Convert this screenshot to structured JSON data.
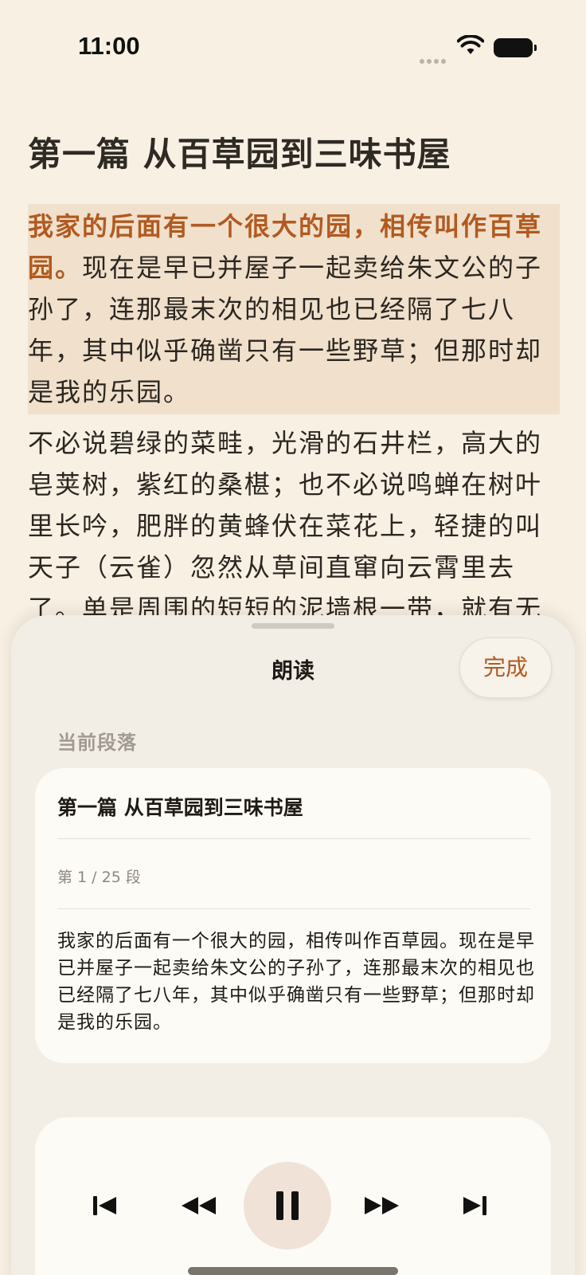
{
  "status_bar": {
    "time": "11:00"
  },
  "article": {
    "title": "第一篇 从百草园到三味书屋",
    "highlight_sentence": "我家的后面有一个很大的园，相传叫作百草园。",
    "highlight_rest": "现在是早已并屋子一起卖给朱文公的子孙了，连那最末次的相见也已经隔了七八年，其中似乎确凿只有一些野草；但那时却是我的乐园。",
    "next_paragraph": "不必说碧绿的菜畦，光滑的石井栏，高大的皂荚树，紫红的桑椹；也不必说鸣蝉在树叶里长吟，肥胖的黄蜂伏在菜花上，轻捷的叫天子（云雀）忽然从草间直窜向云霄里去了。单是周围的短短的泥墙根一带，就有无"
  },
  "sheet": {
    "title": "朗读",
    "done_label": "完成",
    "section_label": "当前段落",
    "card": {
      "title": "第一篇 从百草园到三味书屋",
      "count": "第 1 / 25 段",
      "text": "我家的后面有一个很大的园，相传叫作百草园。现在是早已并屋子一起卖给朱文公的子孙了，连那最末次的相见也已经隔了七八年，其中似乎确凿只有一些野草；但那时却是我的乐园。"
    }
  },
  "player": {
    "controls": [
      "skip-to-start-icon",
      "rewind-icon",
      "pause-icon",
      "fast-forward-icon",
      "skip-to-end-icon"
    ],
    "state": "playing"
  },
  "colors": {
    "accent": "#b15a20",
    "background": "#f7f0e3",
    "highlight": "#f0e0cc",
    "pause_circle": "#f0e2d6"
  }
}
